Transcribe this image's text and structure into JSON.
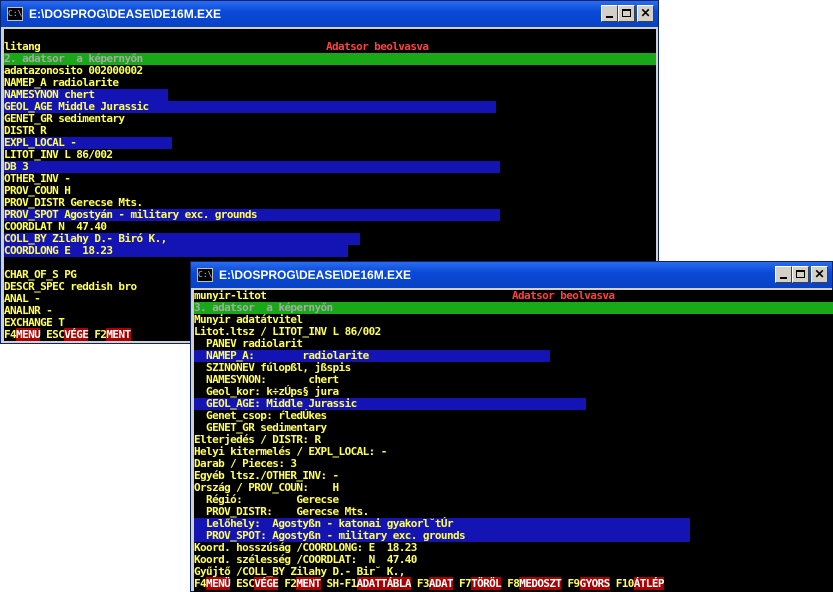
{
  "window1": {
    "title": "E:\\DOSPROG\\DEASE\\DE16M.EXE",
    "header_left": "litang",
    "header_right": "Adatsor beolvasva",
    "status_line": "2. adatsor  a képernyőn",
    "lines": [
      "adatazonosito 002000002",
      "NAMEP_A radiolarite",
      "NAMESYNON chert",
      "GEOL_AGE Middle Jurassic",
      "GENET_GR sedimentary",
      "DISTR R",
      "EXPL_LOCAL -",
      "LITOT_INV L 86/002",
      "DB 3",
      "OTHER_INV -",
      "PROV_COUN H",
      "PROV_DISTR Gerecse Mts.",
      "PROV_SPOT Agostyán - military exc. grounds",
      "COORDLAT N  47.40",
      "COLL_BY Zilahy D.- Biró K.,",
      "COORDLONG E  18.23",
      "",
      "CHAR_OF_S PG",
      "DESCR_SPEC reddish bro",
      "ANAL -",
      "ANALNR -",
      "EXCHANGE T"
    ],
    "fkeys": [
      {
        "key": "F4",
        "label": "MENU"
      },
      {
        "key": " ESC",
        "label": "VÉGE"
      },
      {
        "key": " F2",
        "label": "MENT"
      }
    ]
  },
  "window2": {
    "title": "E:\\DOSPROG\\DEASE\\DE16M.EXE",
    "header_left": "munyir-litot",
    "header_right": "Adatsor beolvasva",
    "status_line": "3. adatsor  a képernyőn",
    "lines": [
      "Munyir adatátvitel",
      "Litot.ltsz / LITOT_INV L 86/002",
      "  PANEV radiolarit",
      "  NAMEP_A:        radiolarite",
      "  SZINONEV fúlopßl, jßspis",
      "  NAMESYNON:       chert",
      "  Geol_kor: k÷zÚps§ jura",
      "  GEOL_AGE: Middle Jurassic",
      "  Genet_csop: ŕledÚkes",
      "  GENET_GR sedimentary",
      "Elterjedés / DISTR: R",
      "Helyi kitermelés / EXPL_LOCAL: -",
      "Darab / Pieces: 3",
      "Egyéb ltsz./OTHER_INV: -",
      "Ország / PROV_COUN:    H",
      "  Régió:         Gerecse",
      "  PROV_DISTR:    Gerecse Mts.",
      "  Lelőhely:  Agostyßn - katonai gyakorl˘tÚr",
      "  PROV_SPOT: Agostyßn - military exc. grounds",
      "Koord. hosszúság /COORDLONG: E  18.23",
      "Koord. szélesség /COORDLAT:  N  47.40",
      "Gyűjtő /COLL_BY Zilahy D.- Bir˘ K.,"
    ],
    "fkeys": [
      {
        "key": "F4",
        "label": "MENÜ"
      },
      {
        "key": " ESC",
        "label": "VÉGE"
      },
      {
        "key": " F2",
        "label": "MENT"
      },
      {
        "key": " SH-F1",
        "label": "ADATTÁBLA"
      },
      {
        "key": " F3",
        "label": "ADAT"
      },
      {
        "key": " F7",
        "label": "TÖRÖL"
      },
      {
        "key": " F8",
        "label": "MEDOSZT"
      },
      {
        "key": " F9",
        "label": "GYORS"
      },
      {
        "key": " F10",
        "label": "ÁTLÉP"
      }
    ]
  },
  "colors": {
    "console_bg": "#000000",
    "text_yellow": "#ffff55",
    "highlight_blue": "#1414b4",
    "status_green": "#18a818",
    "alert_red": "#ff4040",
    "titlebar_blue": "#0a4ad8"
  },
  "icons": {
    "app_icon": "console-icon",
    "minimize": "minimize-icon",
    "maximize": "maximize-icon",
    "close": "close-icon"
  }
}
